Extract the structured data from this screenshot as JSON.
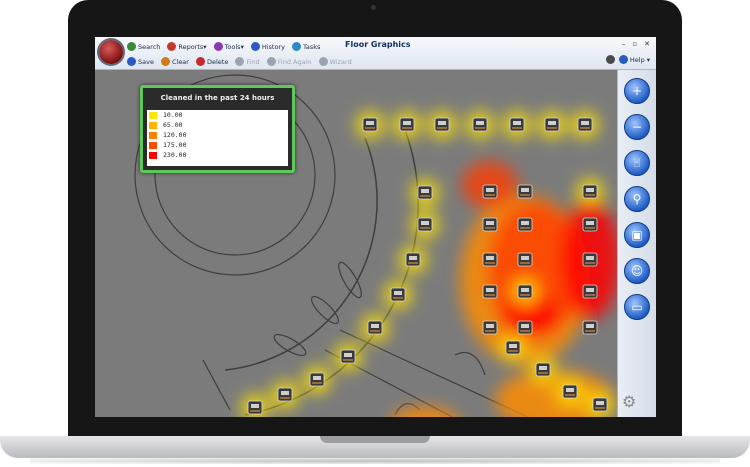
{
  "app": {
    "title": "Floor Graphics",
    "window_controls": [
      "–",
      "▫",
      "✕"
    ]
  },
  "toolbar": {
    "row1": [
      {
        "label": "Search",
        "icon": "search-icon",
        "color": "#3a8a3a"
      },
      {
        "label": "Reports",
        "icon": "reports-icon",
        "color": "#c43a2a",
        "dropdown": "▾"
      },
      {
        "label": "Tools",
        "icon": "tools-icon",
        "color": "#8a3ab0",
        "dropdown": "▾"
      },
      {
        "label": "History",
        "icon": "history-icon",
        "color": "#2a5ac4"
      },
      {
        "label": "Tasks",
        "icon": "tasks-icon",
        "color": "#2a8ac4"
      }
    ],
    "row2": [
      {
        "label": "Save",
        "icon": "save-icon",
        "color": "#2a5ac4",
        "enabled": true
      },
      {
        "label": "Clear",
        "icon": "clear-icon",
        "color": "#d07a1a",
        "enabled": true
      },
      {
        "label": "Delete",
        "icon": "delete-icon",
        "color": "#c42a2a",
        "enabled": true
      },
      {
        "label": "Find",
        "icon": "find-icon",
        "color": "#9aa3b0",
        "enabled": false
      },
      {
        "label": "Find Again",
        "icon": "find-again-icon",
        "color": "#9aa3b0",
        "enabled": false
      },
      {
        "label": "Wizard",
        "icon": "wizard-icon",
        "color": "#9aa3b0",
        "enabled": false
      }
    ],
    "help_label": "Help",
    "help_dropdown": "▾"
  },
  "side_tools": [
    {
      "name": "zoom-in-button",
      "glyph": "+"
    },
    {
      "name": "zoom-out-button",
      "glyph": "−"
    },
    {
      "name": "pan-hand-button",
      "glyph": "☝"
    },
    {
      "name": "search-map-button",
      "glyph": "⚲"
    },
    {
      "name": "snapshot-button",
      "glyph": "▣"
    },
    {
      "name": "user-button",
      "glyph": "☺"
    },
    {
      "name": "window-button",
      "glyph": "▭"
    }
  ],
  "legend": {
    "title": "Cleaned in the past 24 hours",
    "entries": [
      {
        "value": "10.00",
        "color": "#ffe600"
      },
      {
        "value": "65.00",
        "color": "#ffb400"
      },
      {
        "value": "120.00",
        "color": "#ff8000"
      },
      {
        "value": "175.00",
        "color": "#ff4a00"
      },
      {
        "value": "230.00",
        "color": "#ff0000"
      }
    ]
  },
  "colors": {
    "floor_background": "#7b7b7b",
    "legend_border": "#5fc85a",
    "heat_low": "#ffe600",
    "heat_high": "#ff0000"
  },
  "machines": {
    "icon": "slot-machine-icon",
    "arc_count": 14,
    "top_row_count": 7,
    "grid_count": 16
  }
}
